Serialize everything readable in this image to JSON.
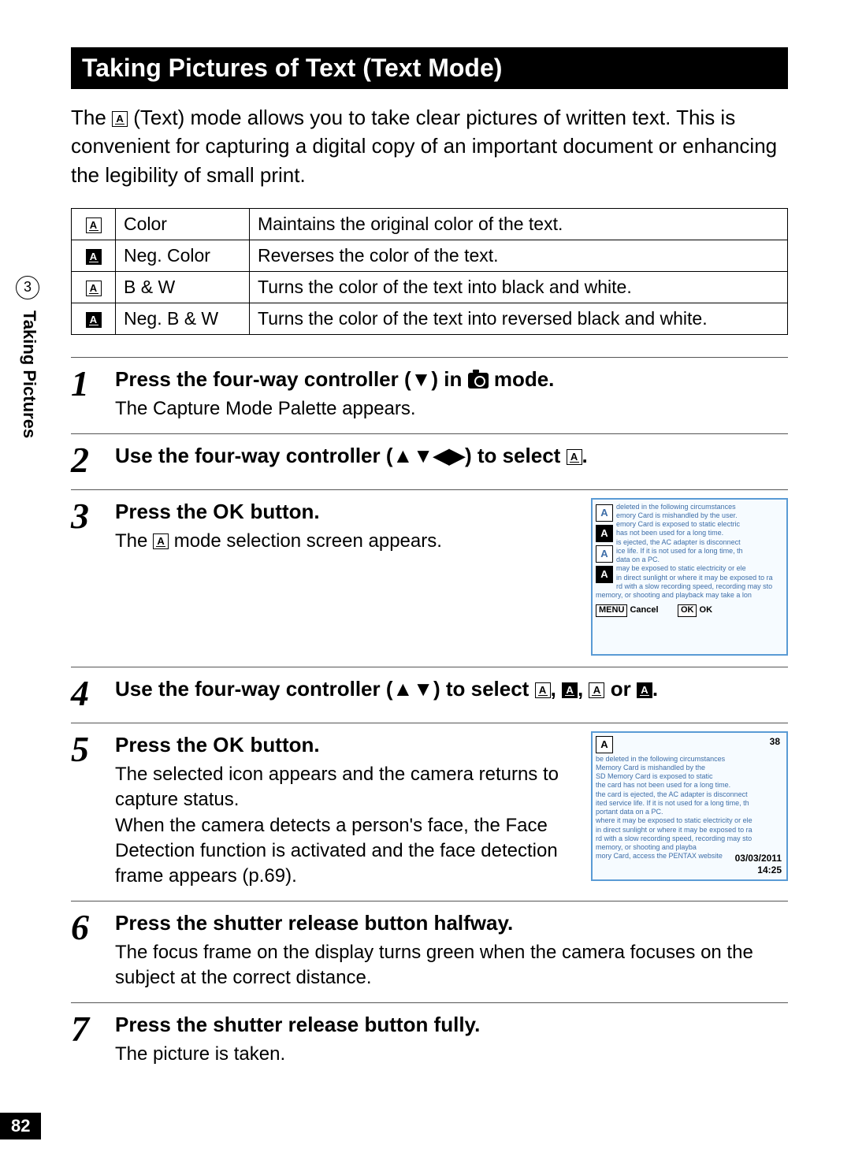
{
  "tab": {
    "chapter": "3",
    "label": "Taking Pictures"
  },
  "page_number": "82",
  "title": "Taking Pictures of Text (Text Mode)",
  "intro_pre": "The ",
  "intro_post": " (Text) mode allows you to take clear pictures of written text. This is convenient for capturing a digital copy of an important document or enhancing the legibility of small print.",
  "modes": [
    {
      "name": "Color",
      "desc": "Maintains the original color of the text."
    },
    {
      "name": "Neg. Color",
      "desc": "Reverses the color of the text."
    },
    {
      "name": "B & W",
      "desc": "Turns the color of the text into black and white."
    },
    {
      "name": "Neg. B & W",
      "desc": "Turns the color of the text into reversed black and white."
    }
  ],
  "steps": {
    "s1": {
      "heading_pre": "Press the four-way controller (▼) in ",
      "heading_post": " mode.",
      "desc": "The Capture Mode Palette appears."
    },
    "s2": {
      "heading_pre": "Use the four-way controller (▲▼◀▶) to select ",
      "heading_post": "."
    },
    "s3": {
      "heading_pre": "Press the ",
      "ok": "OK",
      "heading_post": " button.",
      "desc_pre": "The ",
      "desc_post": " mode selection screen appears.",
      "screen_text": "deleted in the following circumstances\nemory Card is mishandled by the user.\nemory Card is exposed to static electric\nhas not been used for a long time.\nis ejected, the AC adapter is disconnect\nice life. If it is not used for a long time, th\ndata on a PC.\nmay be exposed to static electricity or ele\nin direct sunlight or where it may be exposed to ra\nrd with a slow recording speed, recording may sto\nmemory, or shooting and playback may take a lon",
      "screen_menu": "MENU",
      "screen_cancel": "Cancel",
      "screen_ok1": "OK",
      "screen_ok2": "OK"
    },
    "s4": {
      "heading_pre": "Use the four-way controller (▲▼) to select ",
      "sep": ", ",
      "or": " or ",
      "heading_post": "."
    },
    "s5": {
      "heading_pre": "Press the ",
      "ok": "OK",
      "heading_post": " button.",
      "desc": "The selected icon appears and the camera returns to capture status.\nWhen the camera detects a person's face, the Face Detection function is activated and the face detection frame appears (p.69).",
      "screen_text": "be deleted in the following circumstances\nMemory Card is mishandled by the\nSD Memory Card is exposed to static\nthe card has not been used for a long time.\nthe card is ejected, the AC adapter is disconnect\nited service life. If it is not used for a long time, th\nportant data on a PC.\nwhere it may be exposed to static electricity or ele\nin direct sunlight or where it may be exposed to ra\nrd with a slow recording speed, recording may sto\nmemory, or shooting and playba\nmory Card, access the PENTAX website",
      "screen_count": "38",
      "screen_date": "03/03/2011",
      "screen_time": "14:25"
    },
    "s6": {
      "heading": "Press the shutter release button halfway.",
      "desc": "The focus frame on the display turns green when the camera focuses on the subject at the correct distance."
    },
    "s7": {
      "heading": "Press the shutter release button fully.",
      "desc": "The picture is taken."
    }
  }
}
